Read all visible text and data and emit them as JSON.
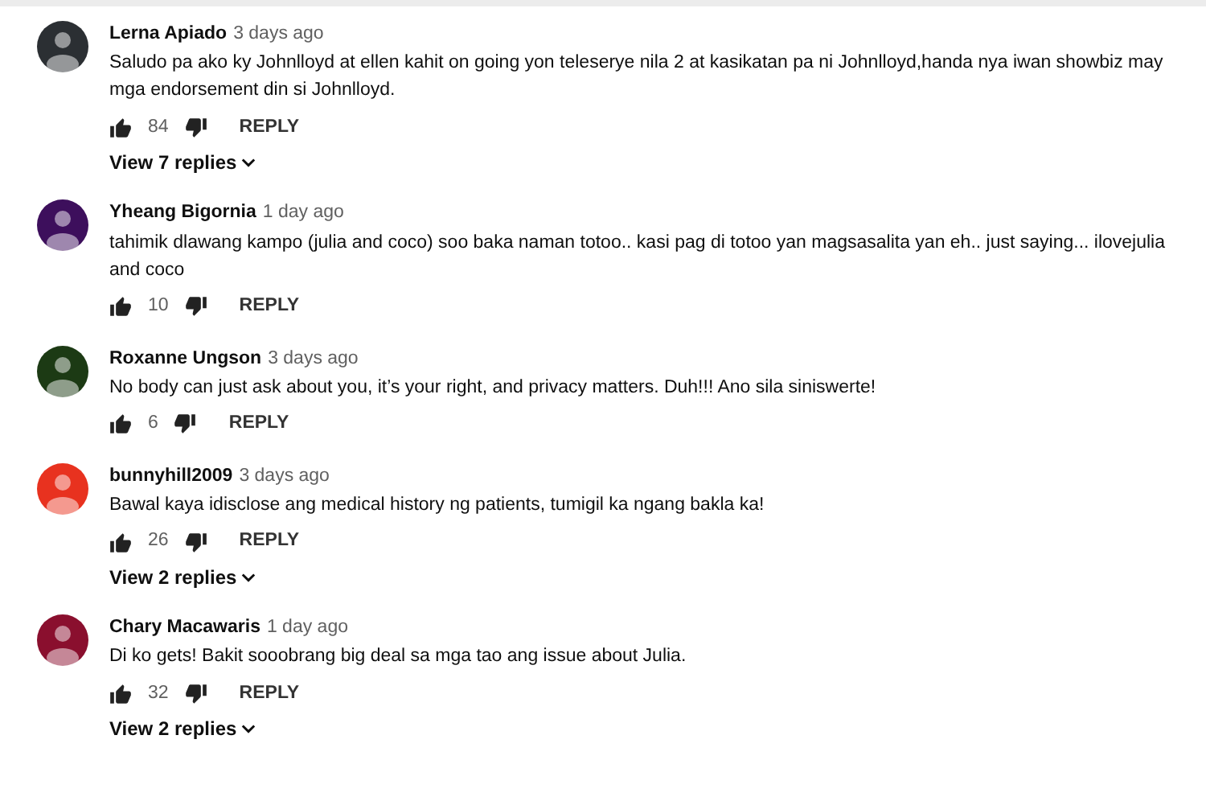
{
  "comments": [
    {
      "author": "Lerna Apiado",
      "time": "3 days ago",
      "color": "#2b2f33",
      "text": "Saludo pa ako ky Johnlloyd at ellen kahit on going yon teleserye nila 2 at kasikatan pa ni Johnlloyd,handa nya iwan showbiz may mga endorsement din si Johnlloyd.",
      "likes": "84",
      "reply": "REPLY",
      "replies": "View 7 replies"
    },
    {
      "author": "Yheang Bigornia",
      "time": "1 day ago",
      "color": "#3d0f5c",
      "text": "tahimik dlawang kampo (julia and coco) soo baka naman totoo..  kasi pag di totoo yan magsasalita yan eh.. just saying...   ilovejulia and coco",
      "likes": "10",
      "reply": "REPLY"
    },
    {
      "author": "Roxanne Ungson",
      "time": "3 days ago",
      "color": "#1c3a14",
      "text": "No body can just ask about you, it’s your right, and privacy matters. Duh!!! Ano sila siniswerte!",
      "likes": "6",
      "reply": "REPLY"
    },
    {
      "author": "bunnyhill2009",
      "time": "3 days ago",
      "color": "#e8321f",
      "text": "Bawal kaya idisclose ang medical history ng patients, tumigil ka ngang bakla ka!",
      "likes": "26",
      "reply": "REPLY",
      "replies": "View 2 replies"
    },
    {
      "author": "Chary Macawaris",
      "time": "1 day ago",
      "color": "#8a0f2e",
      "text": "Di ko gets! Bakit sooobrang big deal sa mga tao ang issue about Julia.",
      "likes": "32",
      "reply": "REPLY",
      "replies": "View 2 replies"
    }
  ]
}
